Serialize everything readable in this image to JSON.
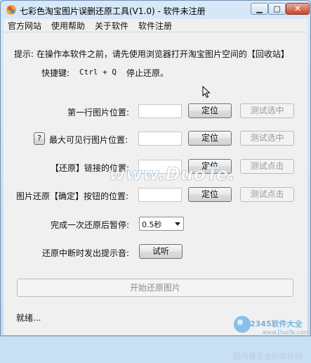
{
  "window": {
    "title": "七彩色淘宝图片误删还原工具(V1.0) - 软件未注册"
  },
  "menu": [
    "官方网站",
    "使用帮助",
    "关于软件",
    "软件注册"
  ],
  "tip": "提示: 在操作本软件之前，请先使用浏览器打开淘宝图片空间的【回收站】",
  "shortcut_label": "快捷键:",
  "shortcut_keys": "Ctrl + Q",
  "shortcut_action": "停止还原。",
  "rows": [
    {
      "label": "第一行图片位置:",
      "locate": "定位",
      "test": "测试选中"
    },
    {
      "label": "最大可见行图片位置:",
      "locate": "定位",
      "test": "测试选中",
      "help": "?"
    },
    {
      "label": "【还原】链接的位置:",
      "locate": "定位",
      "test": "测试点击"
    },
    {
      "label": "图片还原【确定】按钮的位置:",
      "locate": "定位",
      "test": "测试点击"
    }
  ],
  "pause_label": "完成一次还原后暂停:",
  "pause_value": "0.5秒",
  "sound_label": "还原中断时发出提示音:",
  "sound_button": "试听",
  "start_button": "开始还原图片",
  "status": "就绪...",
  "watermarks": {
    "duote": "www.DuoTe.com",
    "brand": "2345软件大全",
    "brand_url": "www.DuoTe.com",
    "brand_sub": "国内最安全的软件站"
  },
  "colors": {
    "titlebar": "#c9dff2",
    "close": "#c5452c",
    "client": "#f0f0f0"
  }
}
